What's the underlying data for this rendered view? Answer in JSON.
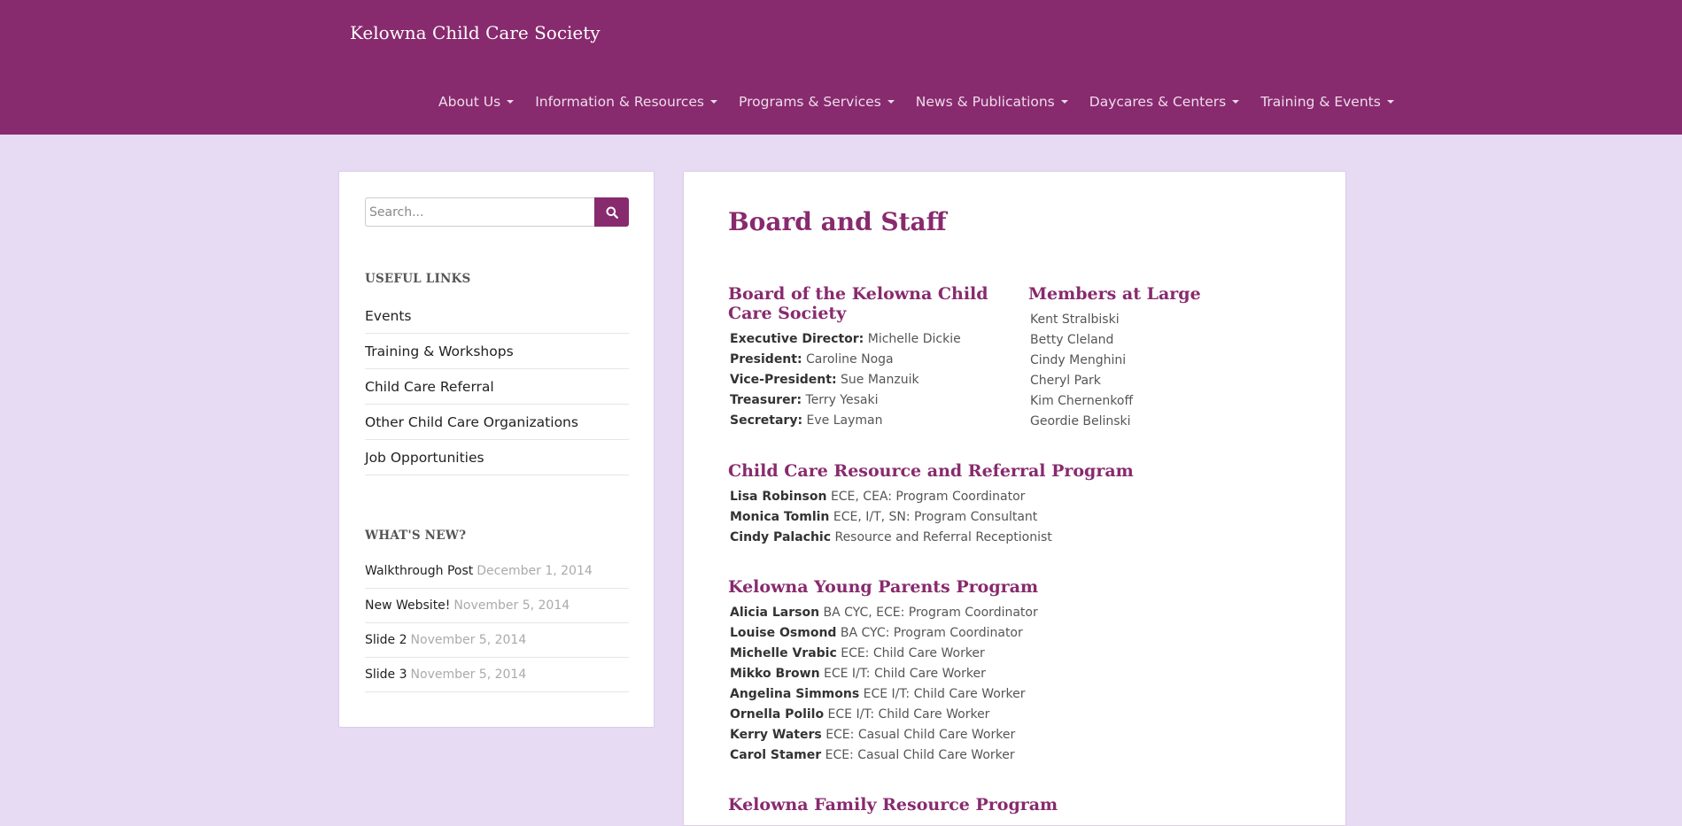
{
  "site": {
    "brand": "Kelowna Child Care Society"
  },
  "nav": [
    {
      "label": "About Us"
    },
    {
      "label": "Information & Resources"
    },
    {
      "label": "Programs & Services"
    },
    {
      "label": "News & Publications"
    },
    {
      "label": "Daycares & Centers"
    },
    {
      "label": "Training & Events"
    }
  ],
  "sidebar": {
    "search": {
      "placeholder": "Search..."
    },
    "useful_links": {
      "title": "USEFUL LINKS",
      "items": [
        {
          "label": "Events"
        },
        {
          "label": "Training & Workshops"
        },
        {
          "label": "Child Care Referral"
        },
        {
          "label": "Other Child Care Organizations"
        },
        {
          "label": "Job Opportunities"
        }
      ]
    },
    "whats_new": {
      "title": "WHAT'S NEW?",
      "items": [
        {
          "title": "Walkthrough Post",
          "date": "December 1, 2014"
        },
        {
          "title": "New Website!",
          "date": "November 5, 2014"
        },
        {
          "title": "Slide 2",
          "date": "November 5, 2014"
        },
        {
          "title": "Slide 3",
          "date": "November 5, 2014"
        }
      ]
    }
  },
  "main": {
    "title": "Board and Staff",
    "board": {
      "heading": "Board of the Kelowna Child Care Society",
      "rows": [
        {
          "role": "Executive Director:",
          "name": "Michelle Dickie"
        },
        {
          "role": "President:",
          "name": "Caroline Noga"
        },
        {
          "role": "Vice-President:",
          "name": "Sue Manzuik"
        },
        {
          "role": "Treasurer:",
          "name": "Terry Yesaki"
        },
        {
          "role": "Secretary:",
          "name": "Eve Layman"
        }
      ]
    },
    "members": {
      "heading": "Members at Large",
      "names": [
        "Kent Stralbiski",
        "Betty Cleland",
        "Cindy Menghini",
        "Cheryl Park",
        "Kim Chernenkoff",
        "Geordie Belinski"
      ]
    },
    "referral": {
      "heading": "Child Care Resource and Referral Program",
      "rows": [
        {
          "name": "Lisa Robinson",
          "role": "ECE, CEA: Program Coordinator"
        },
        {
          "name": "Monica Tomlin",
          "role": "ECE, I/T, SN: Program Consultant"
        },
        {
          "name": "Cindy Palachic",
          "role": "Resource and Referral Receptionist"
        }
      ]
    },
    "young_parents": {
      "heading": "Kelowna Young Parents Program",
      "rows": [
        {
          "name": "Alicia Larson",
          "role": "BA CYC, ECE: Program Coordinator"
        },
        {
          "name": "Louise Osmond",
          "role": "BA CYC: Program Coordinator"
        },
        {
          "name": "Michelle Vrabic",
          "role": "ECE: Child Care Worker"
        },
        {
          "name": "Mikko Brown",
          "role": "ECE I/T: Child Care Worker"
        },
        {
          "name": "Angelina Simmons",
          "role": "ECE I/T: Child Care Worker"
        },
        {
          "name": "Ornella Polilo",
          "role": "ECE I/T: Child Care Worker"
        },
        {
          "name": "Kerry Waters",
          "role": "ECE: Casual Child Care Worker"
        },
        {
          "name": "Carol Stamer",
          "role": "ECE: Casual Child Care Worker"
        }
      ]
    },
    "family_resource": {
      "heading": "Kelowna Family Resource Program"
    }
  }
}
